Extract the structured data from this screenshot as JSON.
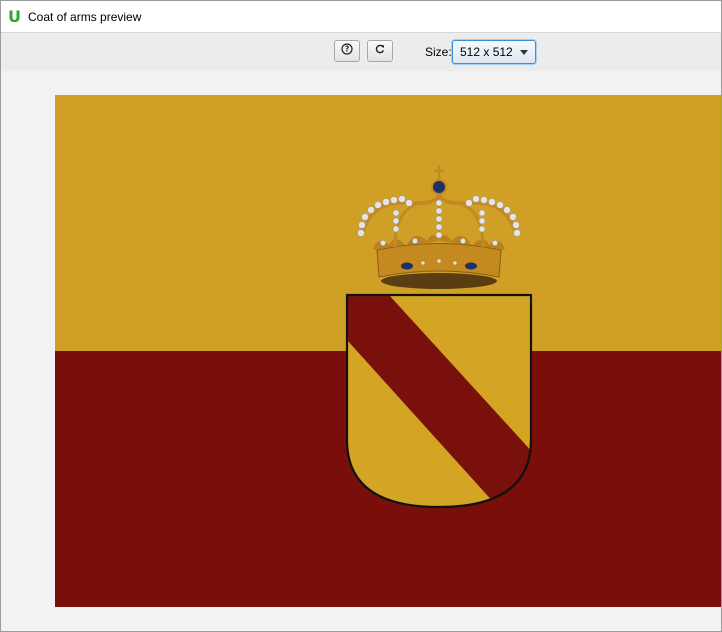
{
  "window": {
    "title": "Coat of arms preview",
    "app_icon": "U"
  },
  "toolbar": {
    "help_icon": "help-icon",
    "refresh_icon": "refresh-icon",
    "size_label": "Size:",
    "size_value": "512 x 512"
  },
  "preview": {
    "flag_top_color": "#cfa025",
    "flag_bottom_color": "#7a0e0a",
    "shield_field_color": "#d4a424",
    "shield_bend_color": "#7a100c",
    "crown_color": "#c48a21"
  }
}
